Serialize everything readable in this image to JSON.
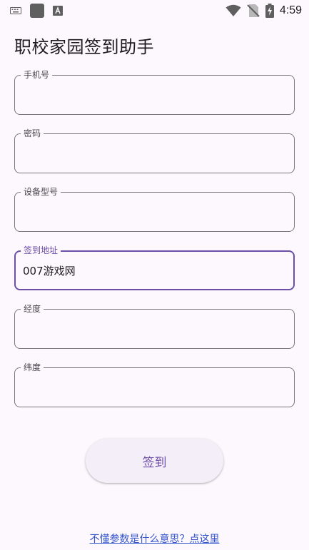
{
  "status_bar": {
    "time": "4:59",
    "icons": [
      "keyboard-icon",
      "square-app-icon",
      "a-box-icon",
      "wifi-icon",
      "no-sim-icon",
      "battery-charging-icon"
    ]
  },
  "app": {
    "title": "职校家园签到助手"
  },
  "form": {
    "fields": [
      {
        "label": "手机号",
        "value": ""
      },
      {
        "label": "密码",
        "value": ""
      },
      {
        "label": "设备型号",
        "value": ""
      },
      {
        "label": "签到地址",
        "value": "007游戏网"
      },
      {
        "label": "经度",
        "value": ""
      },
      {
        "label": "纬度",
        "value": ""
      }
    ],
    "submit_label": "签到"
  },
  "footer": {
    "help_link": "不懂参数是什么意思？点这里"
  },
  "colors": {
    "accent": "#6d4fa8",
    "link": "#3355cc",
    "background": "#fdf8fd"
  }
}
